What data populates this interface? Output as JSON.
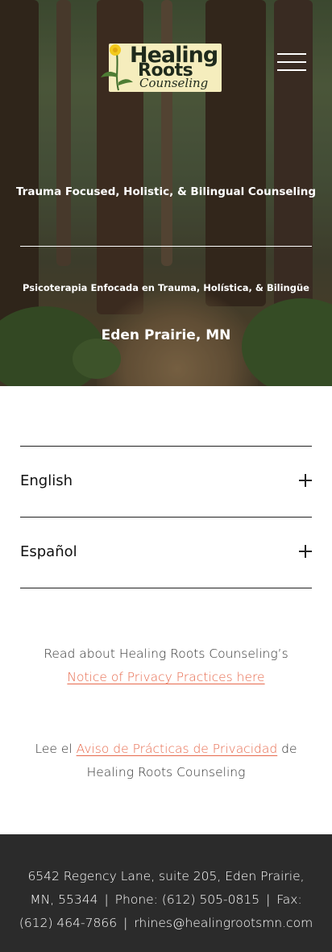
{
  "hero": {
    "logo": {
      "line1": "Healing",
      "line2": "Roots",
      "line3": "Counseling"
    },
    "tagline_en": "Trauma Focused, Holistic, & Bilingual Counseling",
    "tagline_es": "Psicoterapia Enfocada en Trauma, Holística, & Bilingüe",
    "location": "Eden Prairie, MN",
    "menu_icon": "hamburger-menu-icon"
  },
  "accordion": {
    "items": [
      {
        "label": "English",
        "icon": "plus-icon"
      },
      {
        "label": "Español",
        "icon": "plus-icon"
      }
    ]
  },
  "privacy": {
    "en_prefix": "Read about Healing Roots Counseling’s",
    "en_link": "Notice of Privacy Practices here",
    "es_prefix": "Lee el ",
    "es_link": "Aviso de Prácticas de Privacidad",
    "es_suffix": " de Healing Roots Counseling"
  },
  "footer": {
    "address": "6542 Regency Lane, suite 205, Eden Prairie, MN, 55344",
    "separator": "|",
    "phone": "Phone: (612) 505-0815",
    "fax": "Fax: (612) 464-7866",
    "email": "rhines@healingrootsmn.com"
  },
  "colors": {
    "accent_link": "#e76a4d",
    "footer_bg": "#2b2b2b",
    "logo_bg": "#f5edbd"
  }
}
